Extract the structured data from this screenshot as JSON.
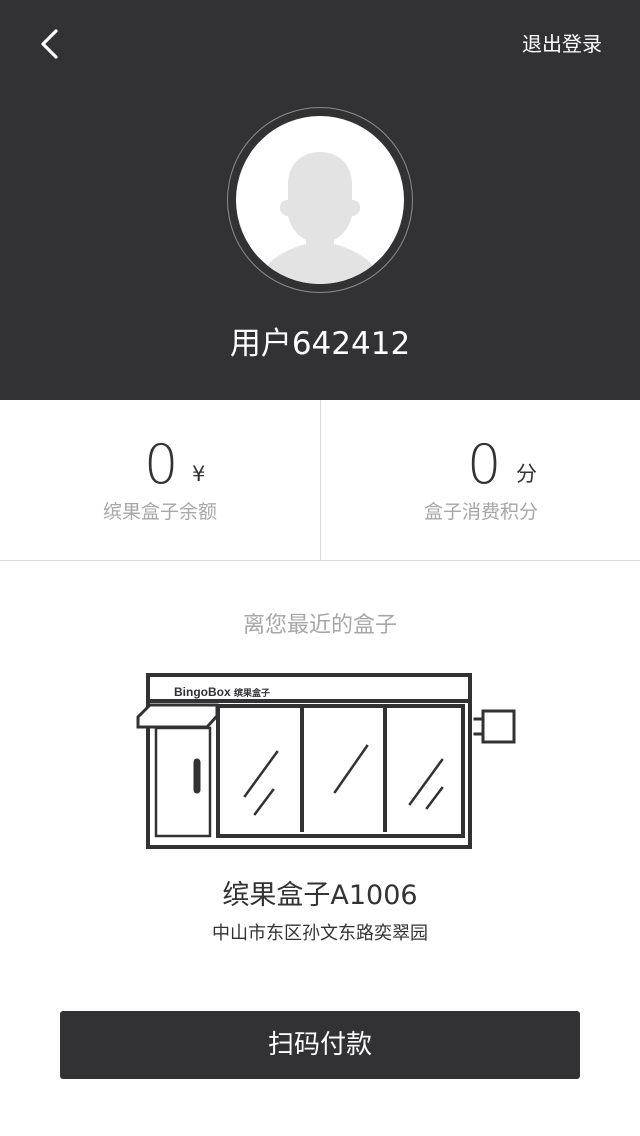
{
  "header": {
    "back_icon": "chevron-left-icon",
    "logout_label": "退出登录",
    "avatar_icon": "user-avatar-icon",
    "username": "用户642412"
  },
  "stats": {
    "balance": {
      "value": "0",
      "unit": "¥",
      "label": "缤果盒子余额"
    },
    "points": {
      "value": "0",
      "unit": "分",
      "label": "盒子消费积分"
    }
  },
  "nearest_box": {
    "heading": "离您最近的盒子",
    "illustration_brand": "BingoBox",
    "illustration_brand_cn": "缤果盒子",
    "name": "缤果盒子A1006",
    "address": "中山市东区孙文东路奕翠园"
  },
  "action": {
    "pay_label": "扫码付款"
  },
  "colors": {
    "header_bg": "#323235",
    "label_gray": "#a7a7a7",
    "text_dark": "#333333",
    "button_bg": "#323235"
  }
}
